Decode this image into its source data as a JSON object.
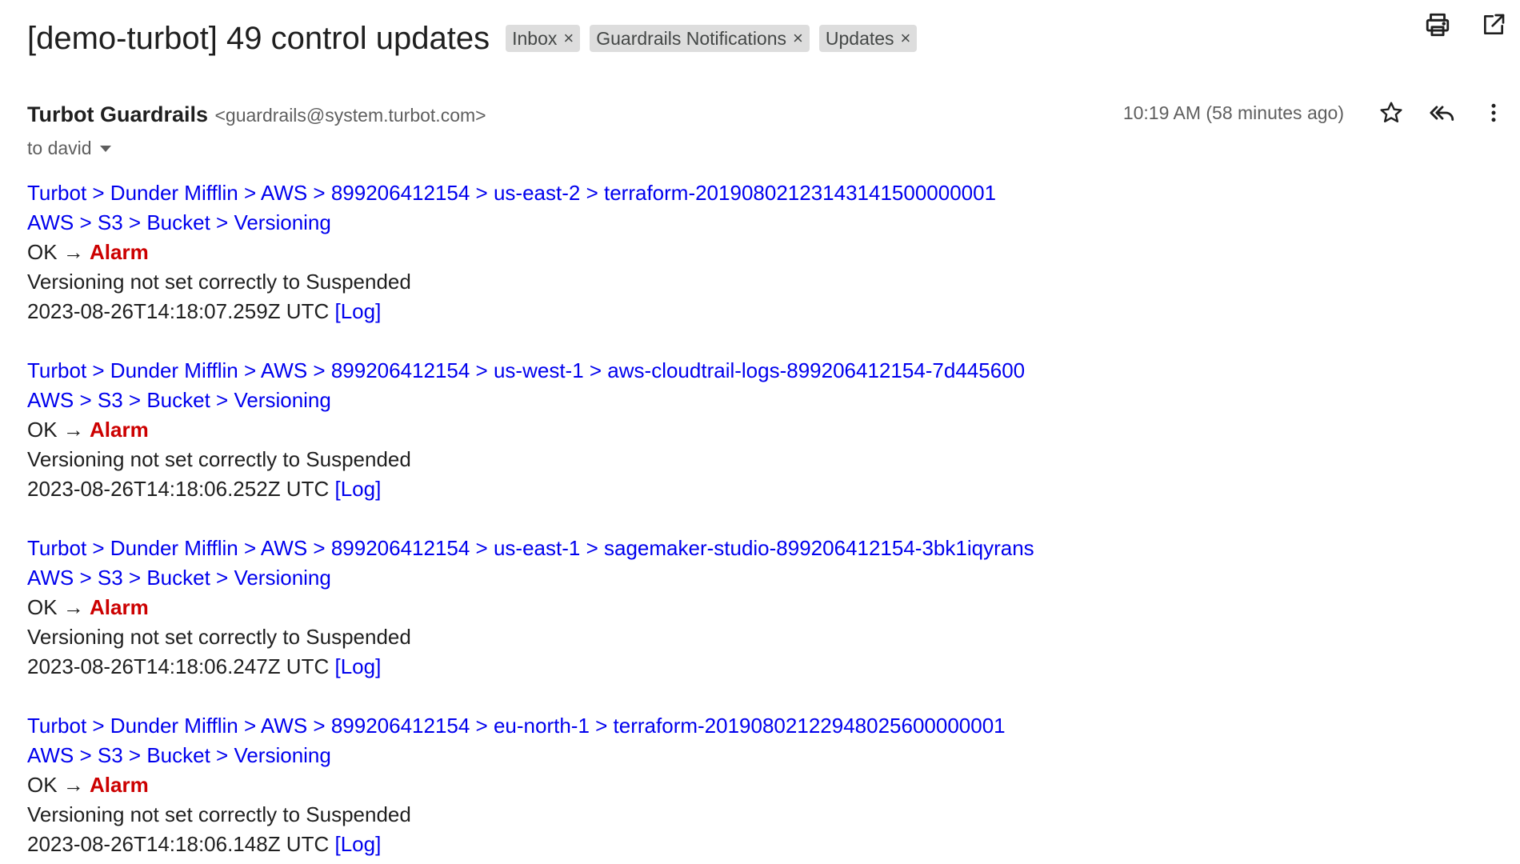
{
  "email": {
    "subject": "[demo-turbot] 49 control updates",
    "labels": [
      {
        "name": "Inbox",
        "remove": "×"
      },
      {
        "name": "Guardrails Notifications",
        "remove": "×"
      },
      {
        "name": "Updates",
        "remove": "×"
      }
    ],
    "sender_name": "Turbot Guardrails",
    "sender_email": "<guardrails@system.turbot.com>",
    "timestamp": "10:19 AM (58 minutes ago)",
    "to": "to david",
    "icons": {
      "print": "print-icon",
      "open_new_window": "open-in-new-window-icon",
      "star": "star-icon",
      "reply_all": "reply-all-icon",
      "more": "more-vertical-icon"
    }
  },
  "entries": [
    {
      "path": "Turbot > Dunder Mifflin > AWS > 899206412154 > us-east-2 > terraform-20190802123143141500000001",
      "control": "AWS > S3 > Bucket > Versioning",
      "state_from": "OK →",
      "state_to": "Alarm",
      "message": "Versioning not set correctly to Suspended",
      "time": "2023-08-26T14:18:07.259Z UTC",
      "log": "[Log]"
    },
    {
      "path": "Turbot > Dunder Mifflin > AWS > 899206412154 > us-west-1 > aws-cloudtrail-logs-899206412154-7d445600",
      "control": "AWS > S3 > Bucket > Versioning",
      "state_from": "OK →",
      "state_to": "Alarm",
      "message": "Versioning not set correctly to Suspended",
      "time": "2023-08-26T14:18:06.252Z UTC",
      "log": "[Log]"
    },
    {
      "path": "Turbot > Dunder Mifflin > AWS > 899206412154 > us-east-1 > sagemaker-studio-899206412154-3bk1iqyrans",
      "control": "AWS > S3 > Bucket > Versioning",
      "state_from": "OK →",
      "state_to": "Alarm",
      "message": "Versioning not set correctly to Suspended",
      "time": "2023-08-26T14:18:06.247Z UTC",
      "log": "[Log]"
    },
    {
      "path": "Turbot > Dunder Mifflin > AWS > 899206412154 > eu-north-1 > terraform-20190802122948025600000001",
      "control": "AWS > S3 > Bucket > Versioning",
      "state_from": "OK →",
      "state_to": "Alarm",
      "message": "Versioning not set correctly to Suspended",
      "time": "2023-08-26T14:18:06.148Z UTC",
      "log": "[Log]"
    }
  ],
  "colors": {
    "link": "#0000ee",
    "alarm": "#cc0000",
    "label_bg": "#dddddd"
  }
}
